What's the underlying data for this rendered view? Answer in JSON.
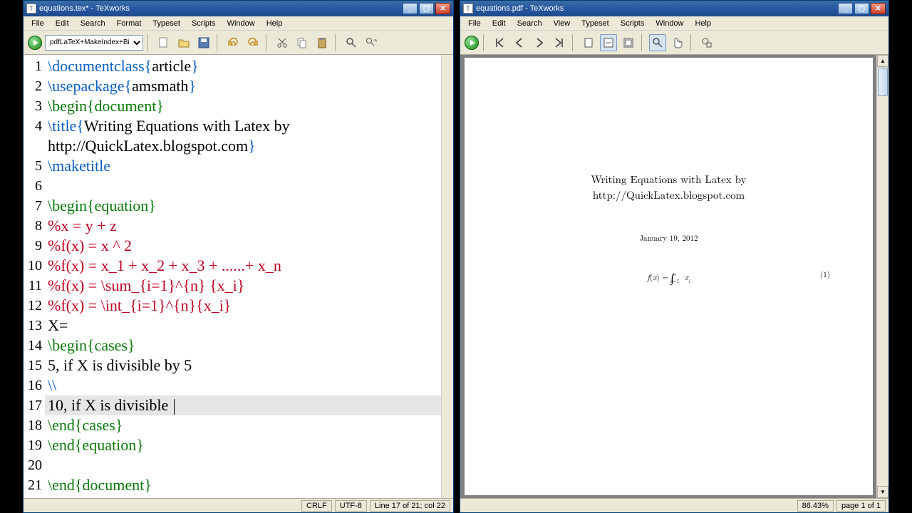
{
  "editor": {
    "title": "equations.tex* - TeXworks",
    "menu": [
      "File",
      "Edit",
      "Search",
      "Format",
      "Typeset",
      "Scripts",
      "Window",
      "Help"
    ],
    "engine": "pdfLaTeX+MakeIndex+BibTeX",
    "status": {
      "lineend": "CRLF",
      "encoding": "UTF-8",
      "pos": "Line 17 of 21; col 22"
    },
    "lines": [
      {
        "n": 1,
        "segs": [
          {
            "t": "\\documentclass{",
            "c": "cmd"
          },
          {
            "t": "article",
            "c": ""
          },
          {
            "t": "}",
            "c": "cmd"
          }
        ]
      },
      {
        "n": 2,
        "segs": [
          {
            "t": "\\usepackage{",
            "c": "cmd"
          },
          {
            "t": "amsmath",
            "c": ""
          },
          {
            "t": "}",
            "c": "cmd"
          }
        ]
      },
      {
        "n": 3,
        "segs": [
          {
            "t": "\\begin{document}",
            "c": "grn"
          }
        ]
      },
      {
        "n": 4,
        "segs": [
          {
            "t": "\\title{",
            "c": "cmd"
          },
          {
            "t": "Writing Equations with Latex by ",
            "c": ""
          }
        ]
      },
      {
        "n": "",
        "segs": [
          {
            "t": "http://QuickLatex.blogspot.com",
            "c": ""
          },
          {
            "t": "}",
            "c": "cmd"
          }
        ]
      },
      {
        "n": 5,
        "segs": [
          {
            "t": "\\maketitle",
            "c": "cmd"
          }
        ]
      },
      {
        "n": 6,
        "segs": []
      },
      {
        "n": 7,
        "segs": [
          {
            "t": "\\begin{equation}",
            "c": "grn"
          }
        ]
      },
      {
        "n": 8,
        "segs": [
          {
            "t": "%x = y + z",
            "c": "red"
          }
        ]
      },
      {
        "n": 9,
        "segs": [
          {
            "t": "%f(x) = x ^ 2",
            "c": "red"
          }
        ]
      },
      {
        "n": 10,
        "segs": [
          {
            "t": "%f(x) = x_1 + x_2 + x_3 + ......+ x_n",
            "c": "red"
          }
        ]
      },
      {
        "n": 11,
        "segs": [
          {
            "t": "%f(x) = \\sum_{i=1}^{n} {x_i}",
            "c": "red"
          }
        ]
      },
      {
        "n": 12,
        "segs": [
          {
            "t": "%f(x) = \\int_{i=1}^{n}{x_i}",
            "c": "red"
          }
        ]
      },
      {
        "n": 13,
        "segs": [
          {
            "t": "X=",
            "c": ""
          }
        ]
      },
      {
        "n": 14,
        "segs": [
          {
            "t": "\\begin{cases}",
            "c": "grn"
          }
        ]
      },
      {
        "n": 15,
        "segs": [
          {
            "t": "5, if X is divisible by 5",
            "c": ""
          }
        ]
      },
      {
        "n": 16,
        "segs": [
          {
            "t": "\\\\",
            "c": "cmd"
          }
        ]
      },
      {
        "n": 17,
        "segs": [
          {
            "t": "10, if X is divisible ",
            "c": ""
          }
        ],
        "active": true,
        "caret": true
      },
      {
        "n": 18,
        "segs": [
          {
            "t": "\\end{cases}",
            "c": "grn"
          }
        ]
      },
      {
        "n": 19,
        "segs": [
          {
            "t": "\\end{equation}",
            "c": "grn"
          }
        ]
      },
      {
        "n": 20,
        "segs": []
      },
      {
        "n": 21,
        "segs": [
          {
            "t": "\\end{document}",
            "c": "grn"
          }
        ]
      }
    ]
  },
  "viewer": {
    "title": "equations.pdf - TeXworks",
    "menu": [
      "File",
      "Edit",
      "Search",
      "View",
      "Typeset",
      "Scripts",
      "Window",
      "Help"
    ],
    "doc_title_l1": "Writing Equations with Latex by",
    "doc_title_l2": "http://QuickLatex.blogspot.com",
    "date": "January 19, 2012",
    "eqnum": "(1)",
    "zoom": "86.43%",
    "page": "page 1 of 1"
  }
}
